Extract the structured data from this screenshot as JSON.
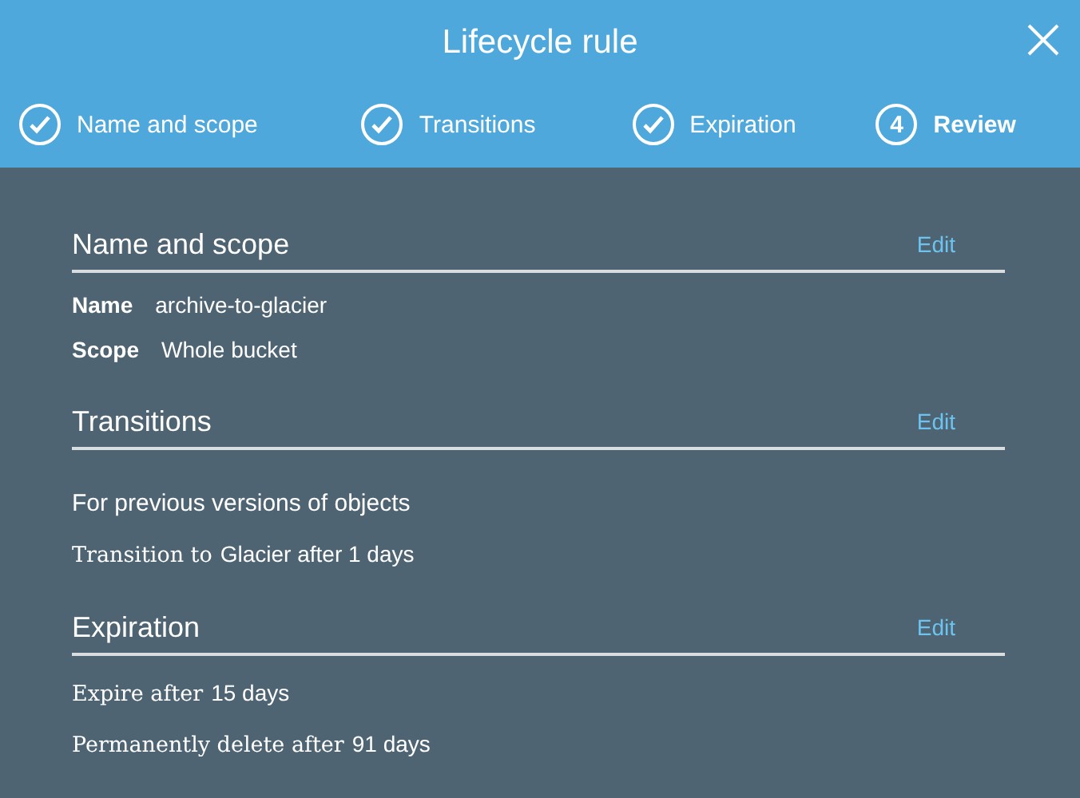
{
  "dialog": {
    "title": "Lifecycle rule"
  },
  "steps": [
    {
      "label": "Name and scope",
      "done": true,
      "selected": false
    },
    {
      "label": "Transitions",
      "done": true,
      "selected": false
    },
    {
      "label": "Expiration",
      "done": true,
      "selected": false
    },
    {
      "label": "Review",
      "number": "4",
      "done": false,
      "selected": true
    }
  ],
  "sections": [
    {
      "title": "Name and scope",
      "edit": "Edit",
      "items": [
        {
          "kind": "field",
          "label": "Name",
          "value": "archive-to-glacier"
        },
        {
          "kind": "field",
          "label": "Scope",
          "value": "Whole bucket"
        }
      ]
    },
    {
      "title": "Transitions",
      "edit": "Edit",
      "items": [
        {
          "kind": "note",
          "text": "For previous versions of objects"
        },
        {
          "kind": "line",
          "label": "Transition to",
          "value": "Glacier after 1 days"
        }
      ]
    },
    {
      "title": "Expiration",
      "edit": "Edit",
      "items": [
        {
          "kind": "line",
          "label": "Expire after",
          "value": "15 days"
        },
        {
          "kind": "line",
          "label": "Permanently delete after",
          "value": "91 days"
        }
      ]
    }
  ]
}
